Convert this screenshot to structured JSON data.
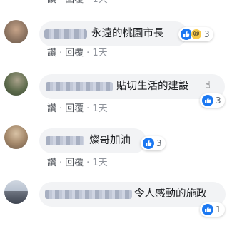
{
  "action_like": "讚",
  "action_reply": "回覆",
  "separator": "·",
  "comments": [
    {
      "text": "永遠的桃園市長",
      "time": "1天",
      "reaction_count": "3"
    },
    {
      "text": "貼切生活的建設",
      "time": "1天",
      "reaction_count": "3"
    },
    {
      "text": "燦哥加油",
      "time": "1天",
      "reaction_count": "3"
    },
    {
      "text": "令人感動的施政",
      "time": "",
      "reaction_count": "1"
    }
  ],
  "top_partial": {
    "time": "1天"
  }
}
